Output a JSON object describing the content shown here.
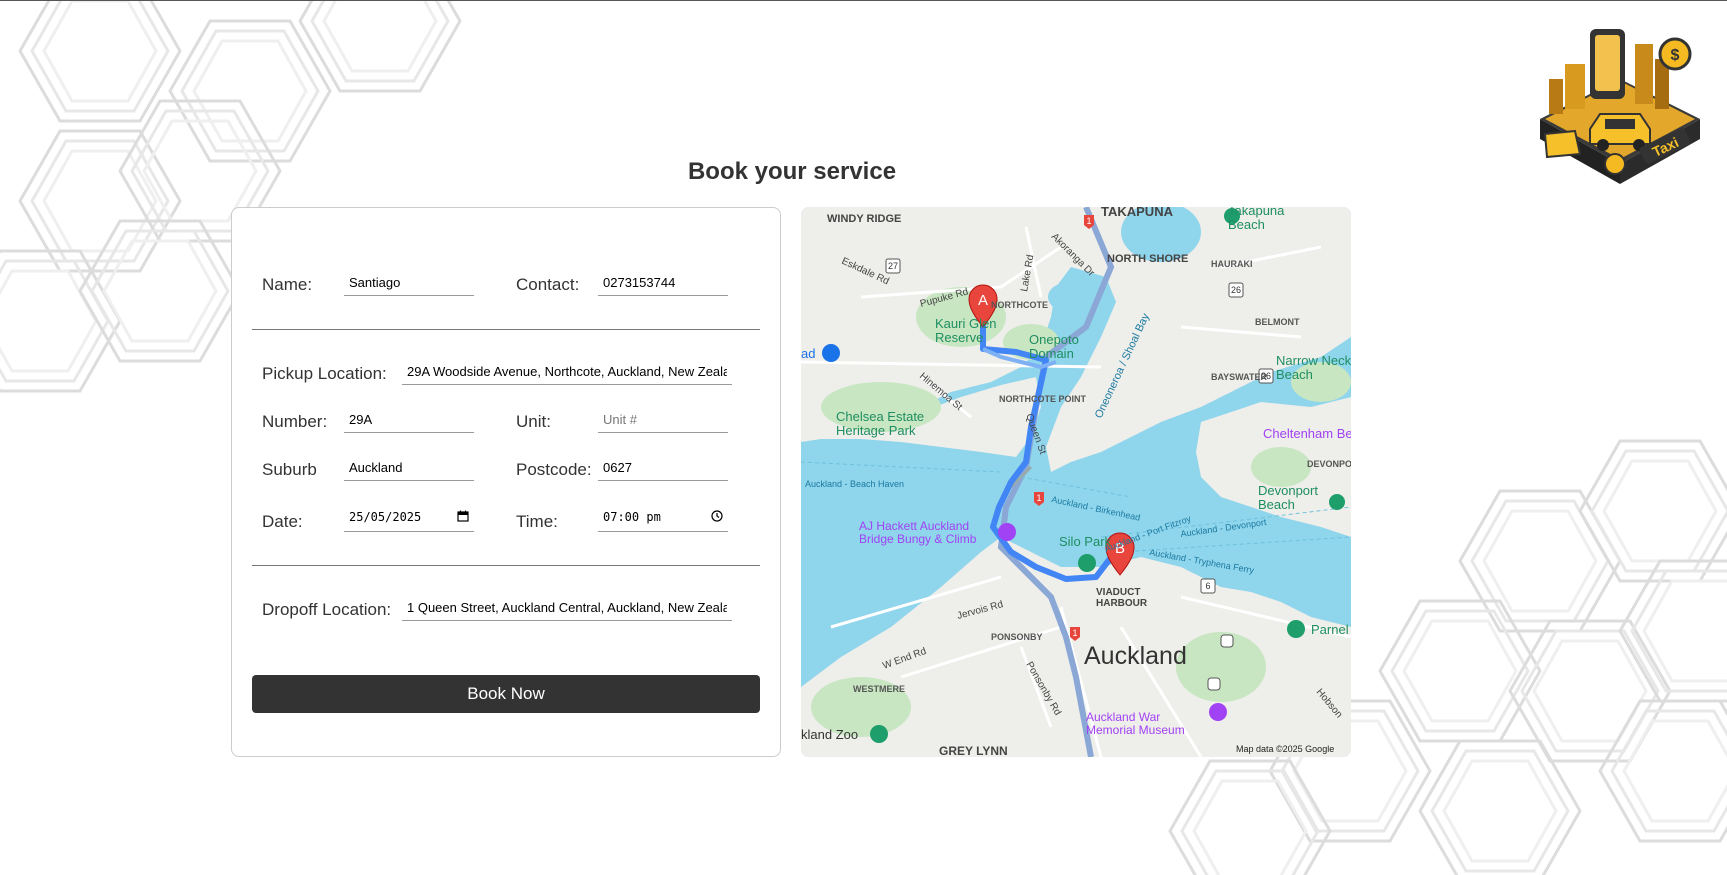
{
  "page": {
    "title": "Book your service"
  },
  "logo": {
    "name": "taxi-logo",
    "label": "Taxi"
  },
  "form": {
    "name_label": "Name:",
    "name_value": "Santiago",
    "contact_label": "Contact:",
    "contact_value": "0273153744",
    "pickup_label": "Pickup Location:",
    "pickup_value": "29A Woodside Avenue, Northcote, Auckland, New Zealand",
    "number_label": "Number:",
    "number_value": "29A",
    "unit_label": "Unit:",
    "unit_value": "",
    "unit_placeholder": "Unit #",
    "suburb_label": "Suburb",
    "suburb_value": "Auckland",
    "postcode_label": "Postcode:",
    "postcode_value": "0627",
    "date_label": "Date:",
    "date_value": "25/05/2025",
    "time_label": "Time:",
    "time_value": "07:00 pm",
    "dropoff_label": "Dropoff Location:",
    "dropoff_value": "1 Queen Street, Auckland Central, Auckland, New Zealand",
    "book_label": "Book Now"
  },
  "map": {
    "labels": {
      "takapuna": "TAKAPUNA",
      "windy_ridge": "WINDY RIDGE",
      "north_shore": "NORTH SHORE",
      "hauraki": "HAURAKI",
      "belmont": "BELMONT",
      "takapuna_beach": "Takapuna Beach",
      "eskdale_rd": "Eskdale Rd",
      "lake_rd": "Lake Rd",
      "akoranga_dr": "Akoranga Dr",
      "pupuke_rd": "Pupuke Rd",
      "northcote": "NORTHCOTE",
      "kauri_glen": "Kauri Glen Reserve",
      "onepoto": "Onepoto Domain",
      "shoal_bay": "Oneoneroa / Shoal Bay",
      "narrow_neck": "Narrow Neck Beach",
      "bayswater": "BAYSWATER",
      "hinemoa_st": "Hinemoa St",
      "northcote_point": "NORTHCOTE POINT",
      "queen_st": "Queen St",
      "chelsea": "Chelsea Estate Heritage Park",
      "cheltenham": "Cheltenham Be",
      "devonport": "DEVONPORT",
      "devonport_beach": "Devonport Beach",
      "beach_haven": "Auckland - Beach Haven",
      "birkenhead": "Auckland - Birkenhead",
      "port_fitzroy": "Auckland - Port Fitzroy",
      "tryphena": "Auckland - Tryphena Ferry",
      "ferry_devonport": "Auckland - Devonport",
      "aj_hackett": "AJ Hackett Auckland Bridge Bungy & Climb",
      "silo_park": "Silo Park",
      "viaduct": "VIADUCT HARBOUR",
      "jervois_rd": "Jervois Rd",
      "ponsonby": "PONSONBY",
      "parnell": "Parnel",
      "w_end_rd": "W End Rd",
      "auckland": "Auckland",
      "ponsonby_rd": "Ponsonby Rd",
      "westmere": "WESTMERE",
      "war_memorial": "Auckland War Memorial Museum",
      "hobson": "Hobson",
      "zoo": "kland Zoo",
      "grey_lynn": "GREY LYNN",
      "ad": "ad",
      "attribution": "Map data ©2025 Google",
      "marker_a": "A",
      "marker_b": "B",
      "route_27": "27",
      "route_26a": "26",
      "route_26b": "26",
      "route_6": "6",
      "route_1a": "1",
      "route_1b": "1",
      "route_1c": "1"
    }
  }
}
